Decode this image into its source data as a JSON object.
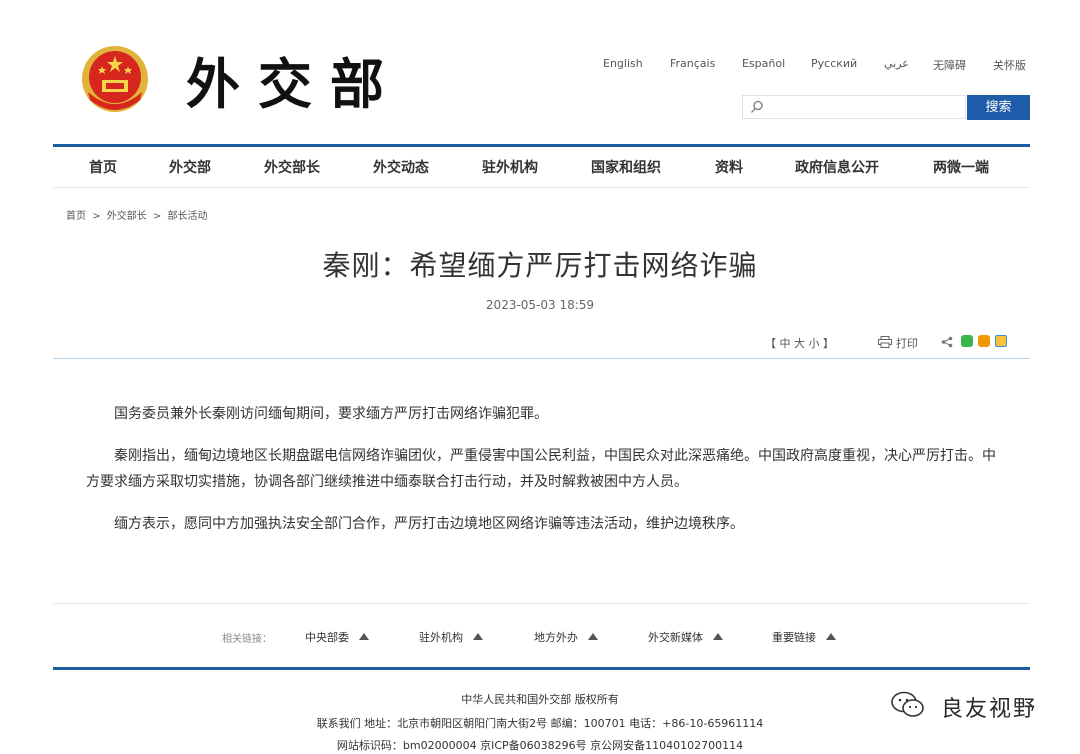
{
  "header": {
    "logo_text": "外交部",
    "languages": [
      "English",
      "Français",
      "Español",
      "Русский",
      "عربي",
      "无障碍",
      "关怀版"
    ],
    "search": {
      "placeholder": "",
      "button_label": "搜索"
    },
    "nav": [
      "首页",
      "外交部",
      "外交部长",
      "外交动态",
      "驻外机构",
      "国家和组织",
      "资料",
      "政府信息公开",
      "两微一端"
    ]
  },
  "breadcrumb": [
    "首页",
    ">",
    "外交部长",
    ">",
    "部长活动"
  ],
  "article": {
    "title": "秦刚：希望缅方严厉打击网络诈骗",
    "date": "2023-05-03 18:59",
    "font_size_label": "【 中  大  小 】",
    "print_label": "打印",
    "paragraphs": [
      "国务委员兼外长秦刚访问缅甸期间，要求缅方严厉打击网络诈骗犯罪。",
      "秦刚指出，缅甸边境地区长期盘踞电信网络诈骗团伙，严重侵害中国公民利益，中国民众对此深恶痛绝。中国政府高度重视，决心严厉打击。中方要求缅方采取切实措施，协调各部门继续推进中缅泰联合打击行动，并及时解救被困中方人员。",
      "缅方表示，愿同中方加强执法安全部门合作，严厉打击边境地区网络诈骗等违法活动，维护边境秩序。"
    ]
  },
  "related": {
    "label": "相关链接：",
    "items": [
      "中央部委",
      "驻外机构",
      "地方外办",
      "外交新媒体",
      "重要链接"
    ]
  },
  "footer": {
    "line1": "中华人民共和国外交部  版权所有",
    "line2": "联系我们    地址：北京市朝阳区朝阳门南大街2号    邮编：100701    电话：+86-10-65961114",
    "line3": "网站标识码：bm02000004    京ICP备06038296号    京公网安备11040102700114"
  },
  "watermark": {
    "text": "良友视野"
  },
  "colors": {
    "brand_blue": "#1f5da3",
    "search_button": "#1e5ba8"
  }
}
